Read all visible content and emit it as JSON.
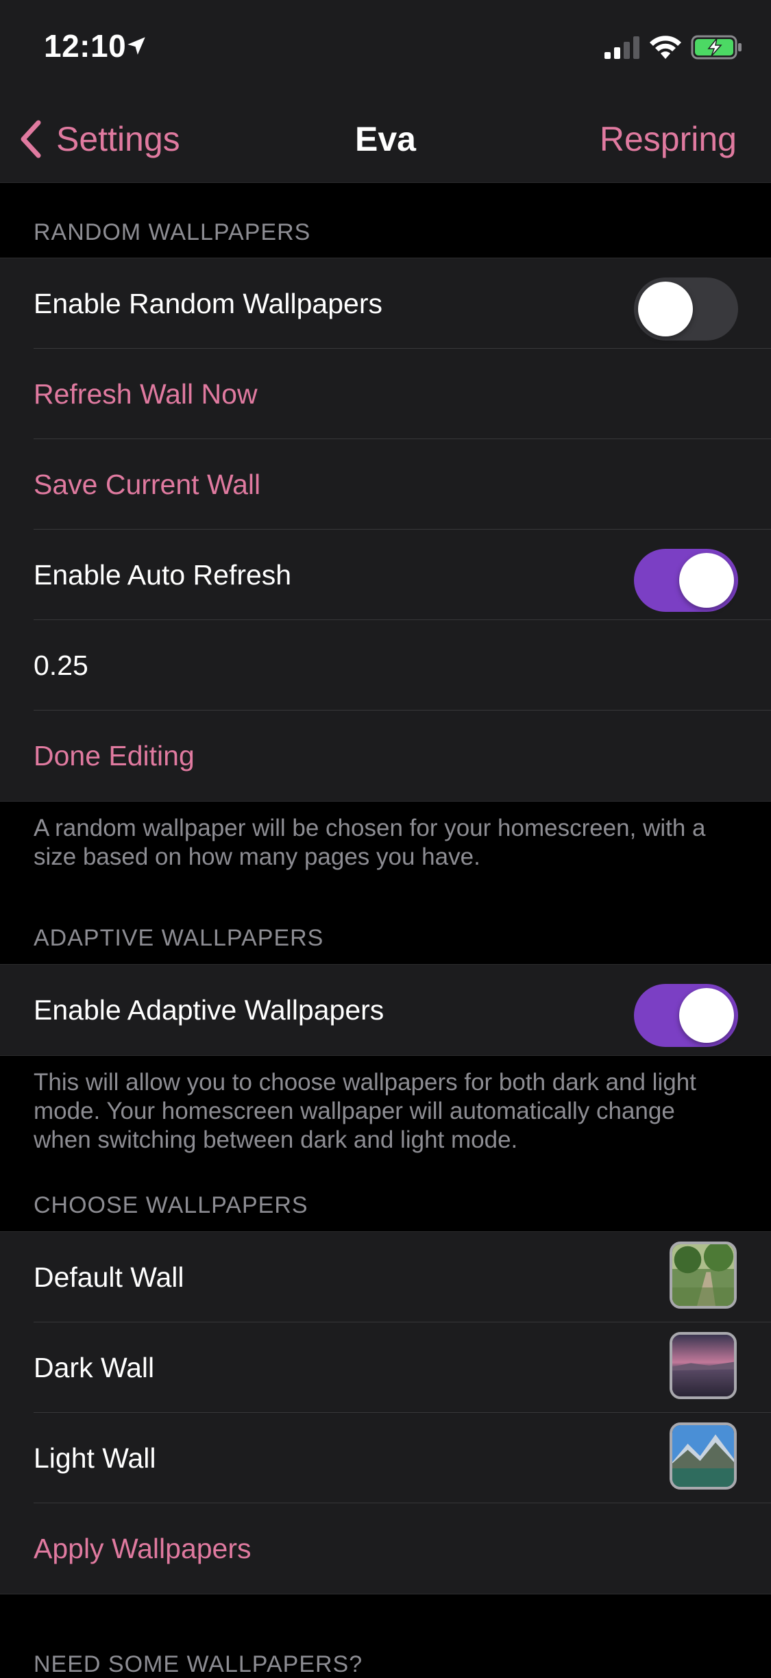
{
  "status_bar": {
    "time": "12:10",
    "icons": [
      "location-arrow-icon",
      "cellular-signal-icon",
      "wifi-icon",
      "battery-charging-icon"
    ]
  },
  "nav": {
    "back_label": "Settings",
    "title": "Eva",
    "right_action": "Respring"
  },
  "sections": {
    "random": {
      "header": "RANDOM WALLPAPERS",
      "enable_label": "Enable Random Wallpapers",
      "enable_on": false,
      "refresh_label": "Refresh Wall Now",
      "save_label": "Save Current Wall",
      "auto_refresh_label": "Enable Auto Refresh",
      "auto_refresh_on": true,
      "interval_value": "0.25",
      "done_label": "Done Editing",
      "footer": "A random wallpaper will be chosen for your homescreen, with a size based on how many pages you have."
    },
    "adaptive": {
      "header": "ADAPTIVE WALLPAPERS",
      "enable_label": "Enable Adaptive Wallpapers",
      "enable_on": true,
      "footer": "This will allow you to choose wallpapers for both dark and light mode. Your homescreen wallpaper will automatically change when switching between dark and light mode."
    },
    "choose": {
      "header": "CHOOSE WALLPAPERS",
      "default_label": "Default Wall",
      "dark_label": "Dark Wall",
      "light_label": "Light Wall",
      "apply_label": "Apply Wallpapers"
    },
    "need": {
      "header": "NEED SOME WALLPAPERS?"
    }
  },
  "colors": {
    "accent": "#e07aa0",
    "toggle_on": "#7b3fc4",
    "cell_background": "#1c1c1e",
    "page_background": "#000000"
  }
}
